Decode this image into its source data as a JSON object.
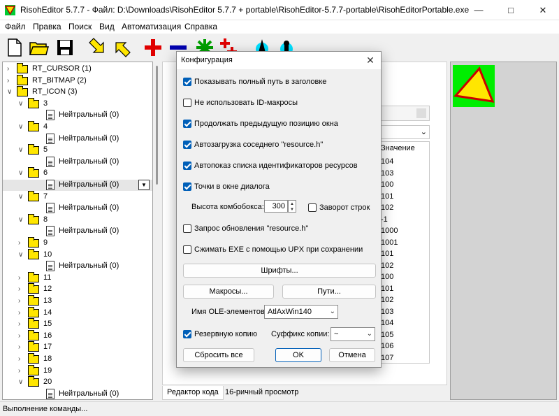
{
  "window": {
    "title": "RisohEditor 5.7.7 - Файл: D:\\Downloads\\RisohEditor 5.7.7 + portable\\RisohEditor-5.7.7-portable\\RisohEditorPortable.exe",
    "minimize_icon": "minimize-icon",
    "maximize_icon": "maximize-icon",
    "close_icon": "close-icon"
  },
  "menu": [
    "Файл",
    "Правка",
    "Поиск",
    "Вид",
    "Автоматизация",
    "Справка"
  ],
  "toolbar": [
    "new-file-icon",
    "open-folder-icon",
    "save-disk-icon",
    "arrow-down-right-icon",
    "arrow-up-left-icon",
    "add-red-plus-icon",
    "remove-minus-icon",
    "green-star-icon",
    "add-multiple-icon",
    "test-dialog-icon",
    "test-dialog-2-icon"
  ],
  "tree": {
    "items": [
      {
        "label": "RT_CURSOR (1)",
        "level": 0,
        "type": "folder",
        "expanded": false
      },
      {
        "label": "RT_BITMAP (2)",
        "level": 0,
        "type": "folder",
        "expanded": false
      },
      {
        "label": "RT_ICON (3)",
        "level": 0,
        "type": "folder",
        "expanded": true
      },
      {
        "label": "3",
        "level": 1,
        "type": "folder",
        "expanded": true
      },
      {
        "label": "Нейтральный (0)",
        "level": 2,
        "type": "doc"
      },
      {
        "label": "4",
        "level": 1,
        "type": "folder",
        "expanded": true
      },
      {
        "label": "Нейтральный (0)",
        "level": 2,
        "type": "doc"
      },
      {
        "label": "5",
        "level": 1,
        "type": "folder",
        "expanded": true
      },
      {
        "label": "Нейтральный (0)",
        "level": 2,
        "type": "doc"
      },
      {
        "label": "6",
        "level": 1,
        "type": "folder",
        "expanded": true
      },
      {
        "label": "Нейтральный (0)",
        "level": 2,
        "type": "doc",
        "selected": true
      },
      {
        "label": "7",
        "level": 1,
        "type": "folder",
        "expanded": true
      },
      {
        "label": "Нейтральный (0)",
        "level": 2,
        "type": "doc"
      },
      {
        "label": "8",
        "level": 1,
        "type": "folder",
        "expanded": true
      },
      {
        "label": "Нейтральный (0)",
        "level": 2,
        "type": "doc"
      },
      {
        "label": "9",
        "level": 1,
        "type": "folder",
        "expanded": false
      },
      {
        "label": "10",
        "level": 1,
        "type": "folder",
        "expanded": true
      },
      {
        "label": "Нейтральный (0)",
        "level": 2,
        "type": "doc"
      },
      {
        "label": "11",
        "level": 1,
        "type": "folder",
        "expanded": false
      },
      {
        "label": "12",
        "level": 1,
        "type": "folder",
        "expanded": false
      },
      {
        "label": "13",
        "level": 1,
        "type": "folder",
        "expanded": false
      },
      {
        "label": "14",
        "level": 1,
        "type": "folder",
        "expanded": false
      },
      {
        "label": "15",
        "level": 1,
        "type": "folder",
        "expanded": false
      },
      {
        "label": "16",
        "level": 1,
        "type": "folder",
        "expanded": false
      },
      {
        "label": "17",
        "level": 1,
        "type": "folder",
        "expanded": false
      },
      {
        "label": "18",
        "level": 1,
        "type": "folder",
        "expanded": false
      },
      {
        "label": "19",
        "level": 1,
        "type": "folder",
        "expanded": false
      },
      {
        "label": "20",
        "level": 1,
        "type": "folder",
        "expanded": true
      },
      {
        "label": "Нейтральный (0)",
        "level": 2,
        "type": "doc"
      }
    ]
  },
  "list_panel": {
    "column_header": "Значение",
    "values": [
      "104",
      "103",
      "100",
      "101",
      "102",
      "-1",
      "1000",
      "1001",
      "101",
      "102",
      "100",
      "101",
      "102",
      "103",
      "104",
      "105",
      "106",
      "107"
    ]
  },
  "bottom_tabs": [
    "Редактор кода",
    "16-ричный просмотр"
  ],
  "status": "Выполнение команды...",
  "dialog": {
    "title": "Конфигурация",
    "checkboxes": [
      {
        "label": "Показывать полный путь в заголовке",
        "checked": true
      },
      {
        "label": "Не использовать ID-макросы",
        "checked": false
      },
      {
        "label": "Продолжать предыдущую позицию окна",
        "checked": true
      },
      {
        "label": "Автозагрузка соседнего \"resource.h\"",
        "checked": true
      },
      {
        "label": "Автопоказ списка идентификаторов ресурсов",
        "checked": true
      },
      {
        "label": "Точки в окне диалога",
        "checked": true
      }
    ],
    "combo_height_label": "Высота комбобокса:",
    "combo_height_value": "300",
    "wrap_lines_label": "Заворот строк",
    "wrap_lines_checked": false,
    "query_update_label": "Запрос обновления \"resource.h\"",
    "query_update_checked": false,
    "upx_label": "Сжимать EXE с помощью UPX при сохранении",
    "upx_checked": false,
    "fonts_button": "Шрифты...",
    "macros_button": "Макросы...",
    "paths_button": "Пути...",
    "ole_label": "Имя OLE-элементов:",
    "ole_value": "AtlAxWin140",
    "backup_label": "Резервную копию",
    "backup_checked": true,
    "backup_suffix_label": "Суффикс копии:",
    "backup_suffix_value": "~",
    "reset_button": "Сбросить все",
    "ok_button": "OK",
    "cancel_button": "Отмена"
  }
}
